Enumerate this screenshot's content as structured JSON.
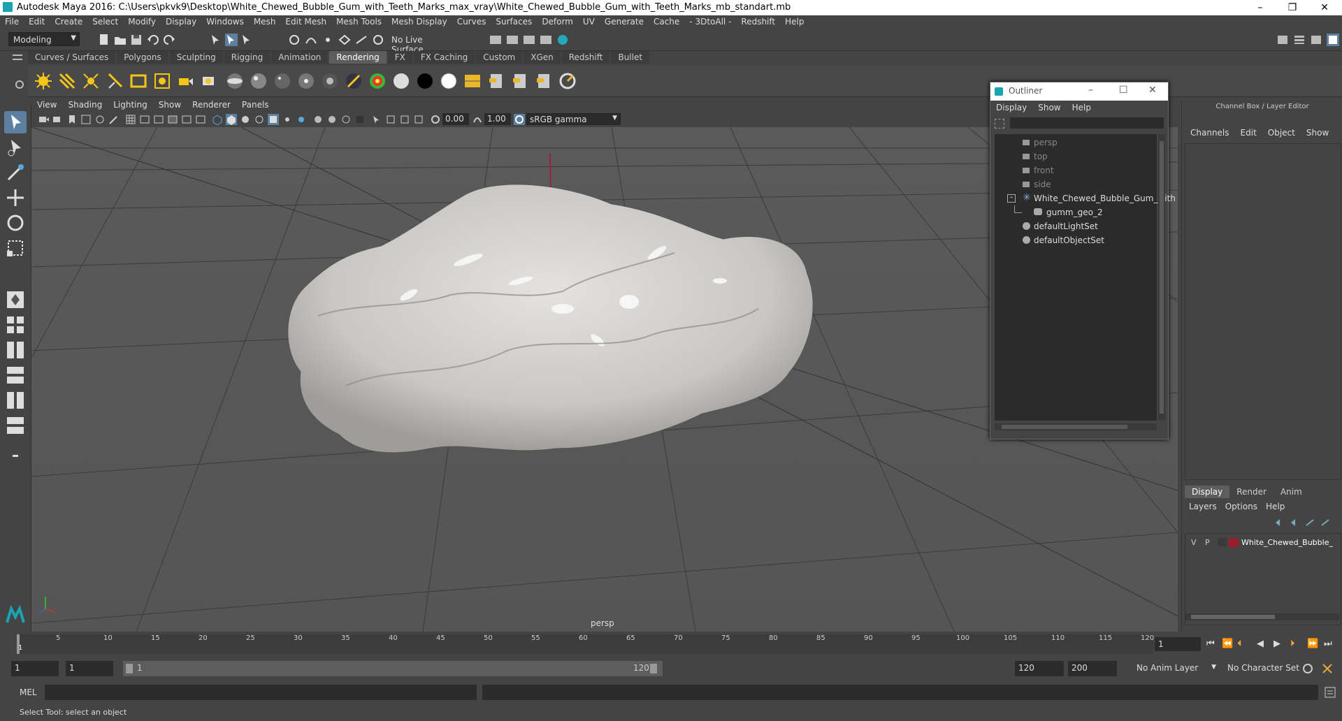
{
  "window": {
    "title": "Autodesk Maya 2016: C:\\Users\\pkvk9\\Desktop\\White_Chewed_Bubble_Gum_with_Teeth_Marks_max_vray\\White_Chewed_Bubble_Gum_with_Teeth_Marks_mb_standart.mb",
    "min": "–",
    "max": "❐",
    "close": "✕"
  },
  "menubar": [
    "File",
    "Edit",
    "Create",
    "Select",
    "Modify",
    "Display",
    "Windows",
    "Mesh",
    "Edit Mesh",
    "Mesh Tools",
    "Mesh Display",
    "Curves",
    "Surfaces",
    "Deform",
    "UV",
    "Generate",
    "Cache",
    "- 3DtoAll -",
    "Redshift",
    "Help"
  ],
  "statusline": {
    "mode": "Modeling",
    "live_surface": "No Live Surface"
  },
  "shelf_tabs": [
    "Curves / Surfaces",
    "Polygons",
    "Sculpting",
    "Rigging",
    "Animation",
    "Rendering",
    "FX",
    "FX Caching",
    "Custom",
    "XGen",
    "Redshift",
    "Bullet"
  ],
  "shelf_active": "Rendering",
  "viewport": {
    "menu": [
      "View",
      "Shading",
      "Lighting",
      "Show",
      "Renderer",
      "Panels"
    ],
    "exposure": "0.00",
    "gamma": "1.00",
    "color_space": "sRGB gamma",
    "camera_label": "persp"
  },
  "outliner": {
    "title": "Outliner",
    "menu": [
      "Display",
      "Show",
      "Help"
    ],
    "items": [
      {
        "label": "persp",
        "dim": true
      },
      {
        "label": "top",
        "dim": true
      },
      {
        "label": "front",
        "dim": true
      },
      {
        "label": "side",
        "dim": true
      },
      {
        "label": "White_Chewed_Bubble_Gum_with",
        "dim": false
      },
      {
        "label": "gumm_geo_2",
        "dim": false
      },
      {
        "label": "defaultLightSet",
        "dim": false
      },
      {
        "label": "defaultObjectSet",
        "dim": false
      }
    ]
  },
  "channelbox": {
    "title": "Channel Box / Layer Editor",
    "menu": [
      "Channels",
      "Edit",
      "Object",
      "Show"
    ],
    "tabs": [
      "Display",
      "Render",
      "Anim"
    ],
    "active_tab": "Display",
    "layer_menu": [
      "Layers",
      "Options",
      "Help"
    ],
    "layer": {
      "v": "V",
      "p": "P",
      "name": "White_Chewed_Bubble_",
      "color": "#9b1c2c"
    }
  },
  "timeline": {
    "ticks": [
      "1",
      "5",
      "10",
      "15",
      "20",
      "25",
      "30",
      "35",
      "40",
      "45",
      "50",
      "55",
      "60",
      "65",
      "70",
      "75",
      "80",
      "85",
      "90",
      "95",
      "100",
      "105",
      "110",
      "115",
      "120"
    ],
    "current_frame": "1"
  },
  "range": {
    "start": "1",
    "start2": "1",
    "slider_start": "1",
    "slider_end": "120",
    "end": "120",
    "end2": "200",
    "anim_layer": "No Anim Layer",
    "char_set": "No Character Set"
  },
  "cmdline": {
    "label": "MEL"
  },
  "helpline": {
    "text": "Select Tool: select an object"
  }
}
